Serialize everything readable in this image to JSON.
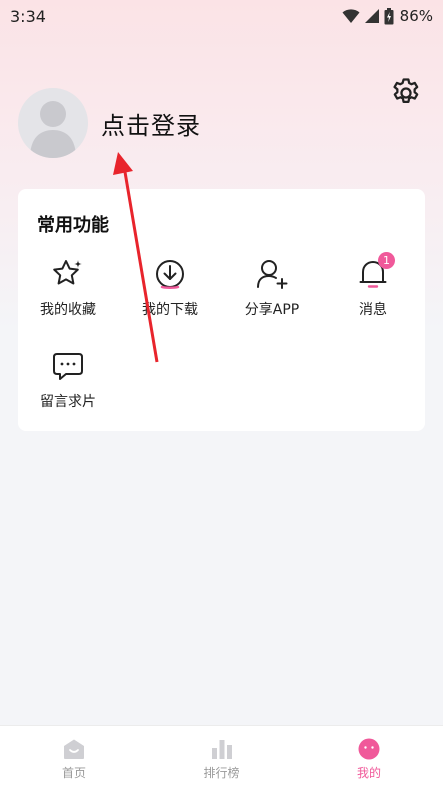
{
  "status_bar": {
    "time": "3:34",
    "battery": "86%"
  },
  "profile": {
    "login_label": "点击登录"
  },
  "features": {
    "title": "常用功能",
    "items": [
      {
        "label": "我的收藏",
        "icon": "star-icon"
      },
      {
        "label": "我的下载",
        "icon": "download-icon"
      },
      {
        "label": "分享APP",
        "icon": "add-user-icon"
      },
      {
        "label": "消息",
        "icon": "bell-icon",
        "badge": "1"
      },
      {
        "label": "留言求片",
        "icon": "message-icon"
      }
    ]
  },
  "bottom_nav": {
    "items": [
      {
        "label": "首页",
        "icon": "home-icon"
      },
      {
        "label": "排行榜",
        "icon": "ranking-icon"
      },
      {
        "label": "我的",
        "icon": "profile-icon",
        "active": true
      }
    ]
  },
  "colors": {
    "accent": "#f0599a",
    "annotation_arrow": "#e8242c"
  }
}
